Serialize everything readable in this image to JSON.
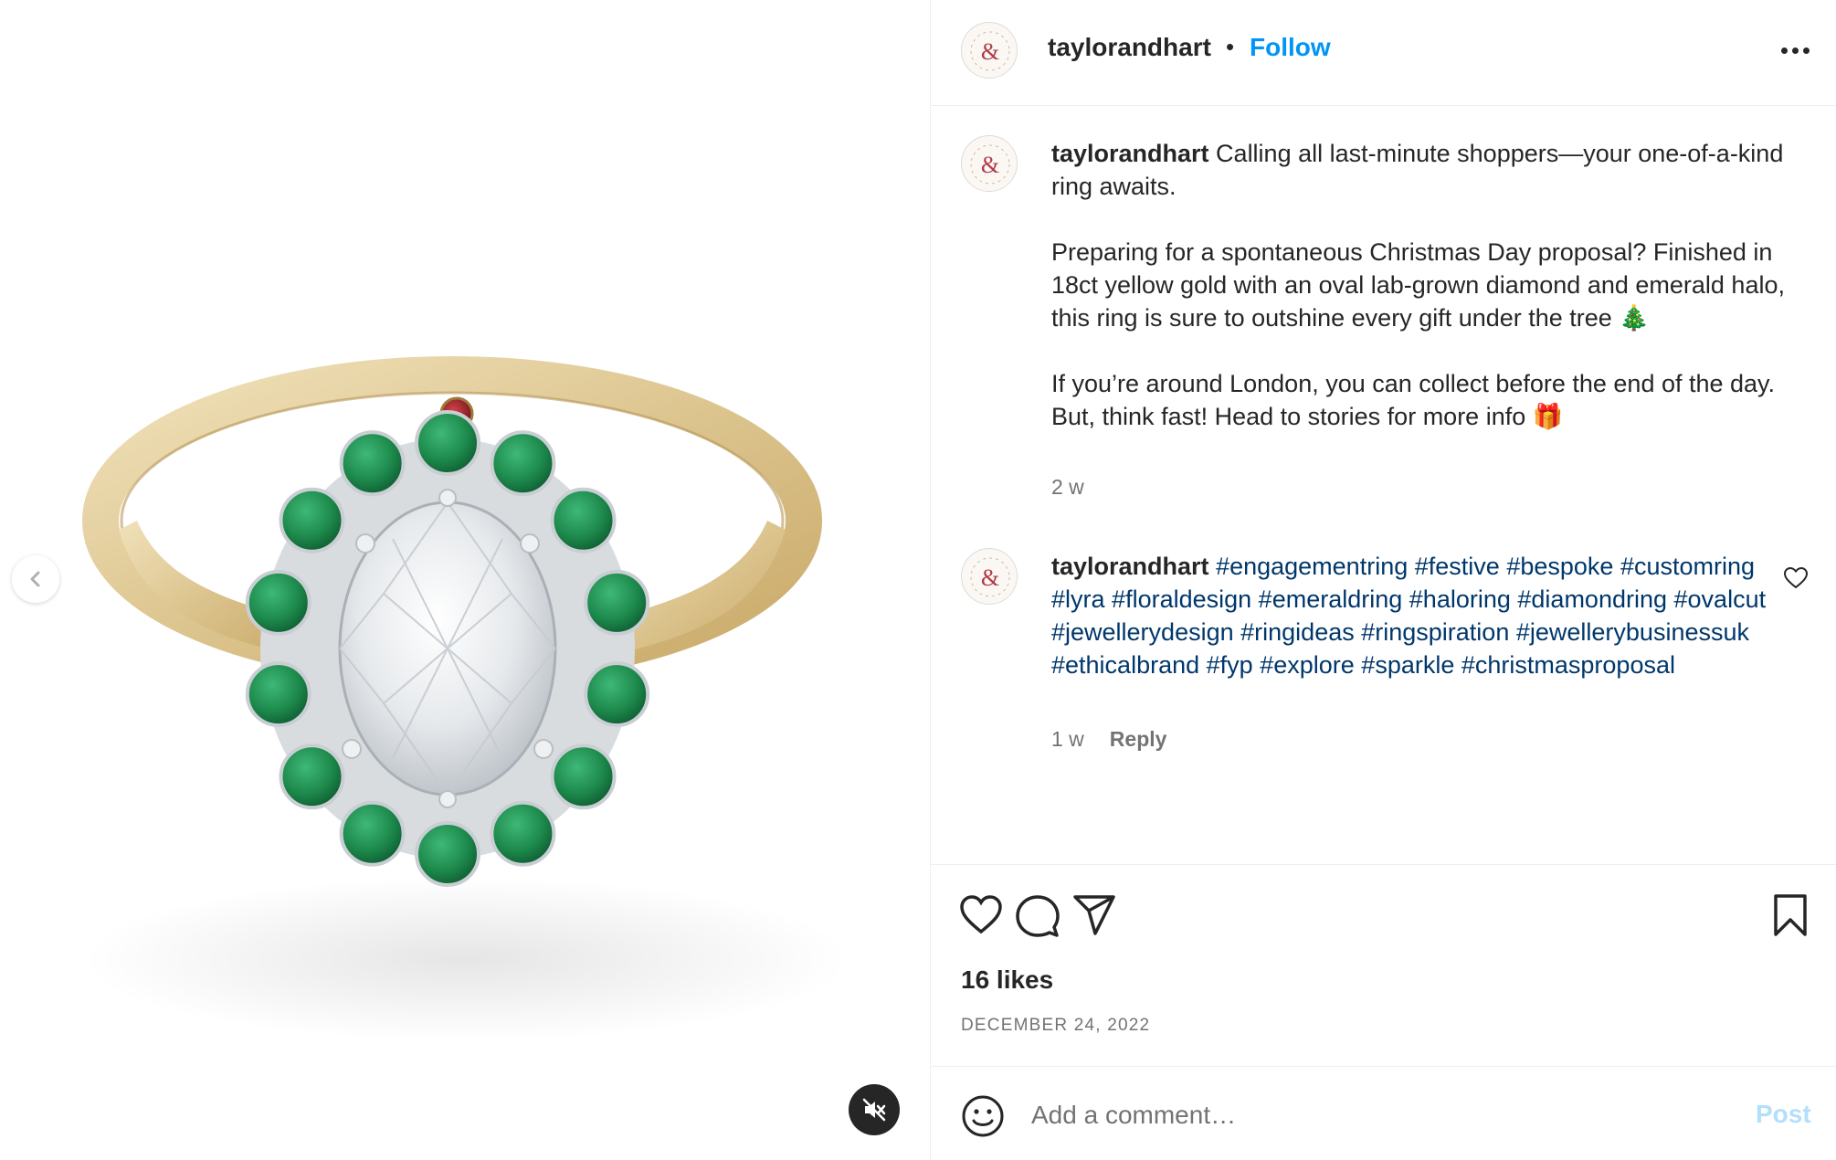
{
  "post": {
    "username": "taylorandhart",
    "separator": "•",
    "follow_label": "Follow",
    "avatar_name": "taylor-and-hart-logo"
  },
  "caption": {
    "username": "taylorandhart",
    "text": " Calling all last-minute shoppers—your one-of-a-kind ring awaits.\n\nPreparing for a spontaneous Christmas Day proposal? Finished in 18ct yellow gold with an oval lab-grown diamond and emerald halo, this ring is sure to outshine every gift under the tree 🎄\n\nIf you’re around London, you can collect before the end of the day. But, think fast! Head to stories for more info 🎁",
    "time": "2 w"
  },
  "comment": {
    "username": "taylorandhart",
    "hashtags": [
      "#engagementring",
      "#festive",
      "#bespoke",
      "#customring",
      "#lyra",
      "#floraldesign",
      "#emeraldring",
      "#haloring",
      "#diamondring",
      "#ovalcut",
      "#jewellerydesign",
      "#ringideas",
      "#ringspiration",
      "#jewellerybusinessuk",
      "#ethicalbrand",
      "#fyp",
      "#explore",
      "#sparkle",
      "#christmasproposal"
    ],
    "time": "1 w",
    "reply_label": "Reply"
  },
  "stats": {
    "likes": "16 likes",
    "date": "DECEMBER 24, 2022"
  },
  "composer": {
    "placeholder": "Add a comment…",
    "post_label": "Post"
  },
  "colors": {
    "link_blue": "#0095f6",
    "hashtag": "#00376b",
    "muted": "#737373",
    "post_disabled": "#b2dffc",
    "gold": "#d9c08a",
    "emerald": "#1f8a4c",
    "ruby": "#8e1b22"
  },
  "icons": {
    "prev": "chevron-left-icon",
    "mute": "speaker-muted-icon",
    "more": "more-options-icon",
    "like": "heart-icon",
    "comment": "speech-bubble-icon",
    "share": "paper-plane-icon",
    "save": "bookmark-icon",
    "emoji": "smiley-icon"
  }
}
